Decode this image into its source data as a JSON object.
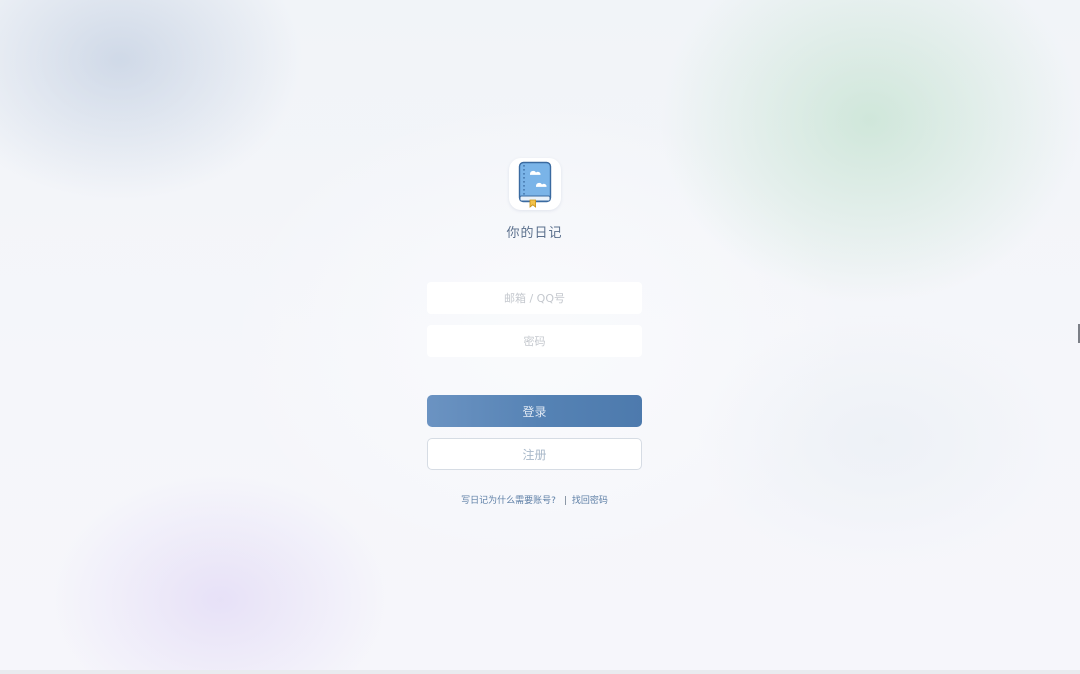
{
  "app": {
    "title": "你的日记",
    "logo_icon": "diary-book-icon"
  },
  "form": {
    "email_placeholder": "邮箱 / QQ号",
    "email_value": "",
    "password_placeholder": "密码",
    "password_value": "",
    "login_label": "登录",
    "register_label": "注册"
  },
  "links": {
    "why_account": "写日记为什么需要账号?",
    "separator": "|",
    "recover_password": "找回密码"
  },
  "colors": {
    "primary_button": "#5582b4",
    "link": "#5d7fa6",
    "title": "#5a6f8c"
  }
}
